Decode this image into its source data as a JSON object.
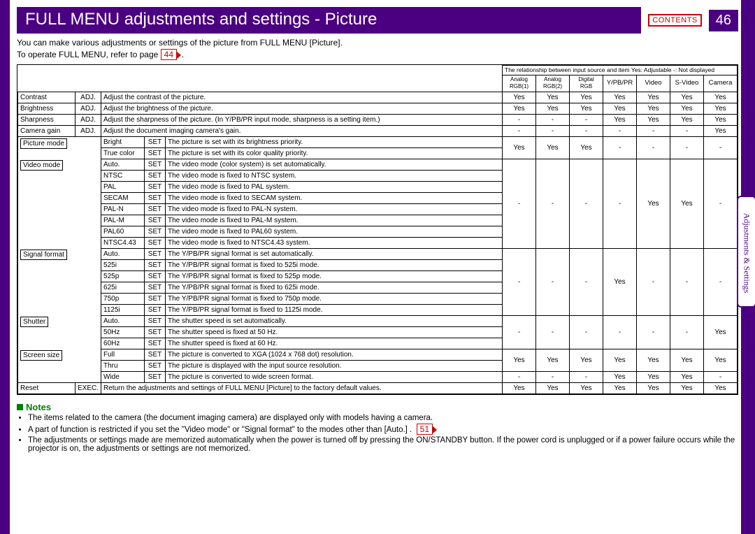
{
  "header": {
    "title": "FULL MENU adjustments and settings - Picture",
    "contents_label": "CONTENTS",
    "page_number": "46",
    "side_tab": "Adjustments & Settings"
  },
  "intro": {
    "line1": "You can make various adjustments or settings of the picture from FULL MENU [Picture].",
    "line2a": "To operate FULL MENU, refer to page",
    "ref1": "44",
    "legend": "The relationship between input source and item     Yes: Adjustable    -: Not displayed"
  },
  "columns": [
    "Analog RGB(1)",
    "Analog RGB(2)",
    "Digital RGB",
    "Y/PB/PR",
    "Video",
    "S-Video",
    "Camera"
  ],
  "rows": [
    {
      "item": "Contrast",
      "tag": "ADJ.",
      "desc": "Adjust the contrast of the picture.",
      "vals": [
        "Yes",
        "Yes",
        "Yes",
        "Yes",
        "Yes",
        "Yes",
        "Yes"
      ]
    },
    {
      "item": "Brightness",
      "tag": "ADJ.",
      "desc": "Adjust the brightness of the picture.",
      "vals": [
        "Yes",
        "Yes",
        "Yes",
        "Yes",
        "Yes",
        "Yes",
        "Yes"
      ]
    },
    {
      "item": "Sharpness",
      "tag": "ADJ.",
      "desc": "Adjust the sharpness of the picture. (In Y/PB/PR input mode, sharpness is a setting item.)",
      "vals": [
        "-",
        "-",
        "-",
        "Yes",
        "Yes",
        "Yes",
        "Yes"
      ]
    },
    {
      "item": "Camera gain",
      "tag": "ADJ.",
      "desc": "Adjust the document imaging camera's gain.",
      "vals": [
        "-",
        "-",
        "-",
        "-",
        "-",
        "-",
        "Yes"
      ]
    }
  ],
  "groups": [
    {
      "item": "Picture mode",
      "vals": [
        "Yes",
        "Yes",
        "Yes",
        "-",
        "-",
        "-",
        "-"
      ],
      "subs": [
        {
          "name": "Bright",
          "tag": "SET",
          "desc": "The picture is set with its brightness priority."
        },
        {
          "name": "True color",
          "tag": "SET",
          "desc": "The picture is set with its color quality priority."
        }
      ]
    },
    {
      "item": "Video mode",
      "vals": [
        "-",
        "-",
        "-",
        "-",
        "Yes",
        "Yes",
        "-"
      ],
      "subs": [
        {
          "name": "Auto.",
          "tag": "SET",
          "desc": "The video mode (color system) is set automatically."
        },
        {
          "name": "NTSC",
          "tag": "SET",
          "desc": "The video mode is fixed to NTSC system."
        },
        {
          "name": "PAL",
          "tag": "SET",
          "desc": "The video mode is fixed to PAL system."
        },
        {
          "name": "SECAM",
          "tag": "SET",
          "desc": "The video mode is fixed to SECAM system."
        },
        {
          "name": "PAL-N",
          "tag": "SET",
          "desc": "The video mode is fixed to PAL-N system."
        },
        {
          "name": "PAL-M",
          "tag": "SET",
          "desc": "The video mode is fixed to PAL-M system."
        },
        {
          "name": "PAL60",
          "tag": "SET",
          "desc": "The video mode is fixed to PAL60 system."
        },
        {
          "name": "NTSC4.43",
          "tag": "SET",
          "desc": "The video mode is fixed to NTSC4.43 system."
        }
      ]
    },
    {
      "item": "Signal format",
      "vals": [
        "-",
        "-",
        "-",
        "Yes",
        "-",
        "-",
        "-"
      ],
      "subs": [
        {
          "name": "Auto.",
          "tag": "SET",
          "desc": "The Y/PB/PR signal format is set automatically."
        },
        {
          "name": "525i",
          "tag": "SET",
          "desc": "The Y/PB/PR signal format is fixed to 525i mode."
        },
        {
          "name": "525p",
          "tag": "SET",
          "desc": "The Y/PB/PR signal format is fixed to 525p mode."
        },
        {
          "name": "625i",
          "tag": "SET",
          "desc": "The Y/PB/PR signal format is fixed to 625i mode."
        },
        {
          "name": "750p",
          "tag": "SET",
          "desc": "The Y/PB/PR signal format is fixed to 750p mode."
        },
        {
          "name": "1125i",
          "tag": "SET",
          "desc": "The Y/PB/PR signal format is fixed to 1125i mode."
        }
      ]
    },
    {
      "item": "Shutter",
      "vals": [
        "-",
        "-",
        "-",
        "-",
        "-",
        "-",
        "Yes"
      ],
      "subs": [
        {
          "name": "Auto.",
          "tag": "SET",
          "desc": "The shutter speed is set automatically."
        },
        {
          "name": "50Hz",
          "tag": "SET",
          "desc": "The shutter speed is fixed at 50 Hz."
        },
        {
          "name": "60Hz",
          "tag": "SET",
          "desc": "The shutter speed is fixed at 60 Hz."
        }
      ]
    },
    {
      "item": "Screen size",
      "vals": [
        "Yes",
        "Yes",
        "Yes",
        "Yes",
        "Yes",
        "Yes",
        "Yes"
      ],
      "vals2": [
        "-",
        "-",
        "-",
        "Yes",
        "Yes",
        "Yes",
        "-"
      ],
      "subs": [
        {
          "name": "Full",
          "tag": "SET",
          "desc": "The picture is converted to XGA (1024 x 768 dot) resolution."
        },
        {
          "name": "Thru",
          "tag": "SET",
          "desc": "The picture is displayed with the input source resolution."
        },
        {
          "name": "Wide",
          "tag": "SET",
          "desc": "The picture is converted to wide screen format."
        }
      ]
    }
  ],
  "reset": {
    "item": "Reset",
    "tag": "EXEC.",
    "desc": "Return the adjustments and settings of FULL MENU [Picture] to the factory default values.",
    "vals": [
      "Yes",
      "Yes",
      "Yes",
      "Yes",
      "Yes",
      "Yes",
      "Yes"
    ]
  },
  "notes": {
    "title": "Notes",
    "items": [
      "The items related to the camera (the document imaging camera) are displayed only with models having a camera.",
      "A part of function is restricted if you set the \"Video mode\" or \"Signal format\" to the modes other than [Auto.] .",
      "The adjustments or settings made are memorized automatically when the power is turned off by pressing the ON/STANDBY button. If the power cord is unplugged or if a power failure occurs while the projector is on, the adjustments or settings are not memorized."
    ],
    "ref2": "51"
  }
}
